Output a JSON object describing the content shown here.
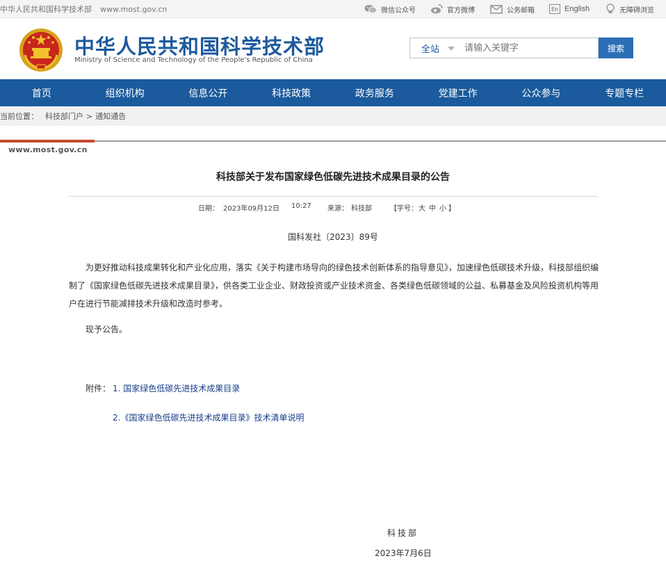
{
  "topbar": {
    "site_name": "中华人民共和国科学技术部",
    "url": "www.most.gov.cn",
    "wechat": "微信公众号",
    "weibo": "官方微博",
    "mailbox": "公务邮箱",
    "en_badge": "En",
    "english": "English",
    "accessible": "无障碍浏览"
  },
  "header": {
    "title_cn": "中华人民共和国科学技术部",
    "title_en": "Ministry of Science and Technology of the People's Republic of China",
    "search_scope": "全站",
    "search_placeholder": "请输入关键字",
    "search_button": "搜索"
  },
  "nav": {
    "items": [
      "首页",
      "组织机构",
      "信息公开",
      "科技政策",
      "政务服务",
      "党建工作",
      "公众参与",
      "专题专栏"
    ]
  },
  "breadcrumb": {
    "prefix": "当前位置：",
    "home": "科技部门户",
    "sep": ">",
    "current": "通知通告"
  },
  "site_mark": "www.most.gov.cn",
  "article": {
    "title": "科技部关于发布国家绿色低碳先进技术成果目录的公告",
    "date_label": "日期：",
    "date": "2023年09月12日",
    "time": "10:27",
    "source_label": "来源：",
    "source": "科技部",
    "font_label": "【字号：",
    "font_large": "大",
    "font_medium": "中",
    "font_small": "小",
    "font_close": "】",
    "doc_number": "国科发社〔2023〕89号",
    "body": "为更好推动科技成果转化和产业化应用，落实《关于构建市场导向的绿色技术创新体系的指导意见》，加速绿色低碳技术升级，科技部组织编制了《国家绿色低碳先进技术成果目录》，供各类工业企业、财政投资或产业技术资金、各类绿色低碳领域的公益、私募基金及风险投资机构等用户在进行节能减排技术升级和改造时参考。",
    "announce": "现予公告。",
    "attachment_label": "附件：",
    "attachment_1": "1. 国家绿色低碳先进技术成果目录",
    "attachment_2": "2.《国家绿色低碳先进技术成果目录》技术清单说明",
    "signer": "科技部",
    "sign_date": "2023年7月6日"
  }
}
